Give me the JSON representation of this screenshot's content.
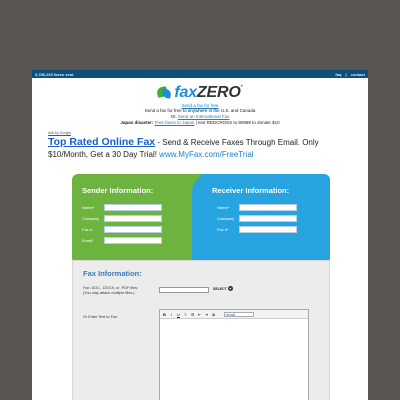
{
  "topbar": {
    "faxes_sent": "3,786,203 faxes sent",
    "faq": "faq",
    "contact": "contact"
  },
  "logo": {
    "fax": "fax",
    "zero": "ZERO",
    "reg": "®"
  },
  "header": {
    "send_link": "Send a fax for free",
    "line1": "Send a fax for free to anywhere in the U.S. and Canada",
    "or": "Or,",
    "intl_link": "Send an International Fax",
    "japan_label": "Japan disaster:",
    "japan_link": "Free faxes to Japan",
    "japan_rest": "| text REDCROSS to 90999 to donate $10"
  },
  "ad": {
    "ads_by": "Ads by Google",
    "title": "Top Rated Online Fax",
    "desc": " - Send & Receive Faxes Through Email. Only $10/Month, Get a 30 Day Trial! ",
    "url": "www.MyFax.com/FreeTrial"
  },
  "sender": {
    "title": "Sender Information:",
    "name": "Name*",
    "company": "Company",
    "fax": "Fax #",
    "email": "Email*"
  },
  "receiver": {
    "title": "Receiver Information:",
    "name": "Name*",
    "company": "Company",
    "fax": "Fax #*"
  },
  "fax_info": {
    "title": "Fax Information:",
    "file_label_1": "Fax .DOC, .DOCX, or .PDF files:",
    "file_label_2": "(You may attach multiple files.)",
    "select": "SELECT",
    "plus": "+",
    "text_label": "Or Enter Text to Fax:",
    "bold": "B",
    "italic": "I",
    "underline": "U",
    "format": "format"
  },
  "colors": {
    "topbar": "#0c4f7c",
    "sender_green": "#6cb33f",
    "receiver_blue": "#27a3e0",
    "link": "#1a7fc9",
    "ad_title": "#1a5fcc"
  }
}
